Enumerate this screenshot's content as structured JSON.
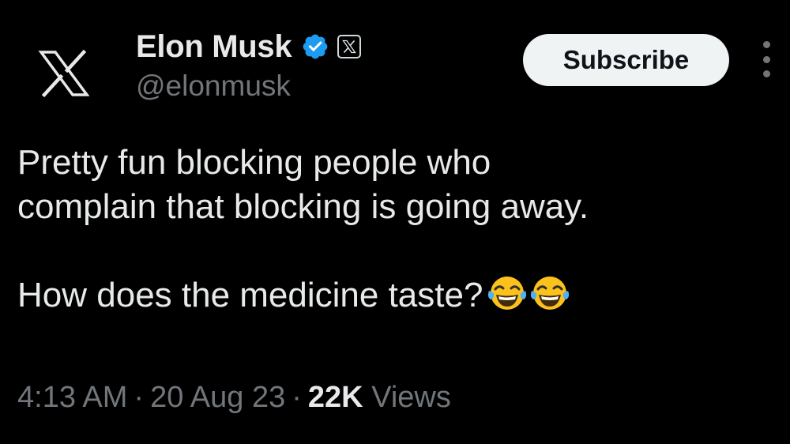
{
  "author": {
    "display_name": "Elon Musk",
    "handle": "@elonmusk",
    "verified_color": "#1d9bf0",
    "avatar_icon": "x-logo-icon",
    "affiliate_badge_icon": "x-logo-icon"
  },
  "actions": {
    "subscribe_label": "Subscribe",
    "more_icon": "more-vertical-icon"
  },
  "tweet": {
    "line_1": "Pretty fun blocking people who",
    "line_2": "complain that blocking is going away.",
    "line_3": "How does the medicine taste?",
    "emoji": "face-with-tears-of-joy"
  },
  "meta": {
    "time": "4:13 AM",
    "separator": "·",
    "date": "20 Aug 23",
    "views_count": "22K",
    "views_label": "Views"
  },
  "colors": {
    "background": "#000000",
    "primary_text": "#e7e9ea",
    "secondary_text": "#71767b",
    "button_bg": "#eff3f4",
    "button_text": "#0f1419"
  }
}
